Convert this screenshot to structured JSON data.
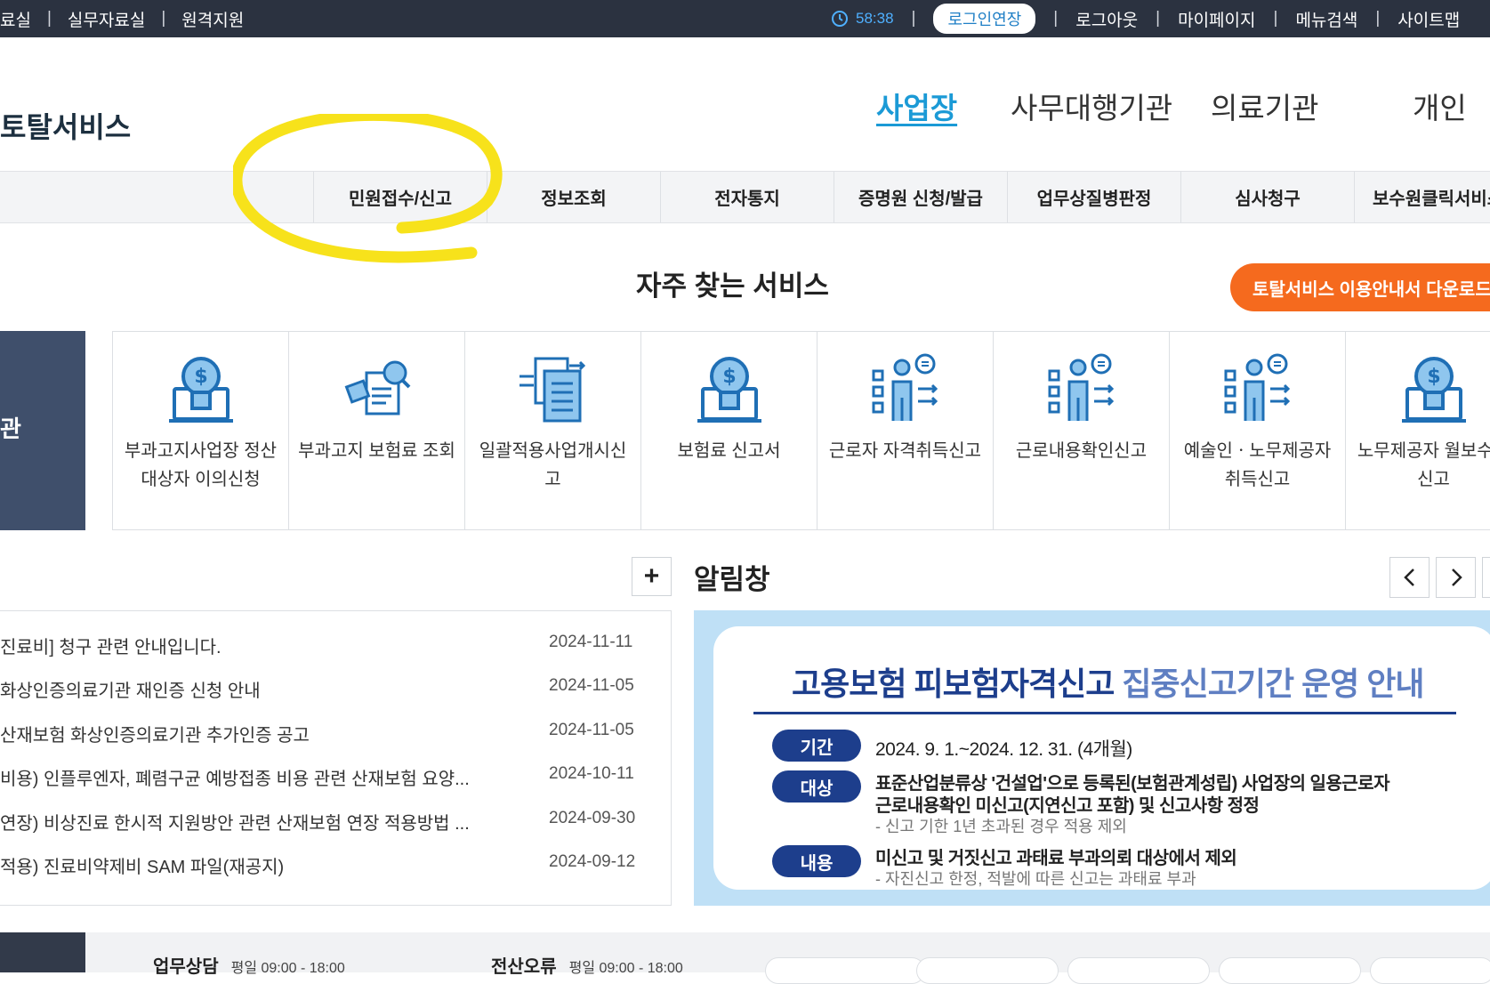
{
  "topbar": {
    "left_links": [
      "료실",
      "실무자료실",
      "원격지원"
    ],
    "timer": "58:38",
    "extend_login": "로그인연장",
    "right_links": [
      "로그아웃",
      "마이페이지",
      "메뉴검색",
      "사이트맵"
    ]
  },
  "header": {
    "logo": "토탈서비스",
    "user_tabs": [
      "사업장",
      "사무대행기관",
      "의료기관",
      "개인"
    ]
  },
  "gnb": {
    "items": [
      "민원접수/신고",
      "정보조회",
      "전자통지",
      "증명원 신청/발급",
      "업무상질병판정",
      "심사청구",
      "보수원클릭서비스"
    ]
  },
  "favorites": {
    "title": "자주 찾는 서비스",
    "guide_button": "토탈서비스 이용안내서 다운로드",
    "side_label": "관",
    "items": [
      {
        "label": "부과고지사업장 정산대상자 이의신청",
        "icon": "money-laptop-icon"
      },
      {
        "label": "부과고지 보험료 조회",
        "icon": "document-search-icon"
      },
      {
        "label": "일괄적용사업개시신고",
        "icon": "document-transfer-icon"
      },
      {
        "label": "보험료 신고서",
        "icon": "money-laptop-icon"
      },
      {
        "label": "근로자 자격취득신고",
        "icon": "worker-report-icon"
      },
      {
        "label": "근로내용확인신고",
        "icon": "worker-report-icon"
      },
      {
        "label": "예술인ㆍ노무제공자 취득신고",
        "icon": "worker-report-icon"
      },
      {
        "label": "노무제공자 월보수액 신고",
        "icon": "money-laptop-icon"
      }
    ]
  },
  "notices": {
    "more_label": "+",
    "items": [
      {
        "title": "진료비] 청구 관련 안내입니다.",
        "date": "2024-11-11"
      },
      {
        "title": "화상인증의료기관 재인증 신청 안내",
        "date": "2024-11-05"
      },
      {
        "title": "산재보험 화상인증의료기관 추가인증 공고",
        "date": "2024-11-05"
      },
      {
        "title": "비용) 인플루엔자, 폐렴구균 예방접종 비용 관련 산재보험 요양...",
        "date": "2024-10-11"
      },
      {
        "title": "연장) 비상진료 한시적 지원방안 관련 산재보험 연장 적용방법 ...",
        "date": "2024-09-30"
      },
      {
        "title": "적용) 진료비약제비 SAM 파일(재공지)",
        "date": "2024-09-12"
      }
    ]
  },
  "alarm": {
    "title": "알림창",
    "banner": {
      "title_main": "고용보험 피보험자격신고",
      "title_sub": "집중신고기간 운영 안내",
      "period_tag": "기간",
      "period": "2024. 9. 1.~2024. 12. 31. (4개월)",
      "target_tag": "대상",
      "target_line1": "표준산업분류상 '건설업'으로 등록된(보험관계성립) 사업장의 일용근로자",
      "target_line2": "근로내용확인 미신고(지연신고 포함) 및 신고사항 정정",
      "target_note": "- 신고 기한 1년 초과된 경우 적용 제외",
      "content_tag": "내용",
      "content_line": "미신고 및 거짓신고 과태료 부과의뢰 대상에서 제외",
      "content_note": "- 자진신고 한정, 적발에 따른 신고는 과태료 부과"
    }
  },
  "contacts": [
    {
      "label": "업무상담",
      "hours": "평일 09:00 - 18:00"
    },
    {
      "label": "전산오류",
      "hours": "평일 09:00 - 18:00"
    }
  ],
  "colors": {
    "topbar": "#2b3240",
    "accent": "#1b9ad6",
    "guide_button": "#f56a1e",
    "banner_navy": "#1d3e8c",
    "highlight": "#f7e21b"
  }
}
